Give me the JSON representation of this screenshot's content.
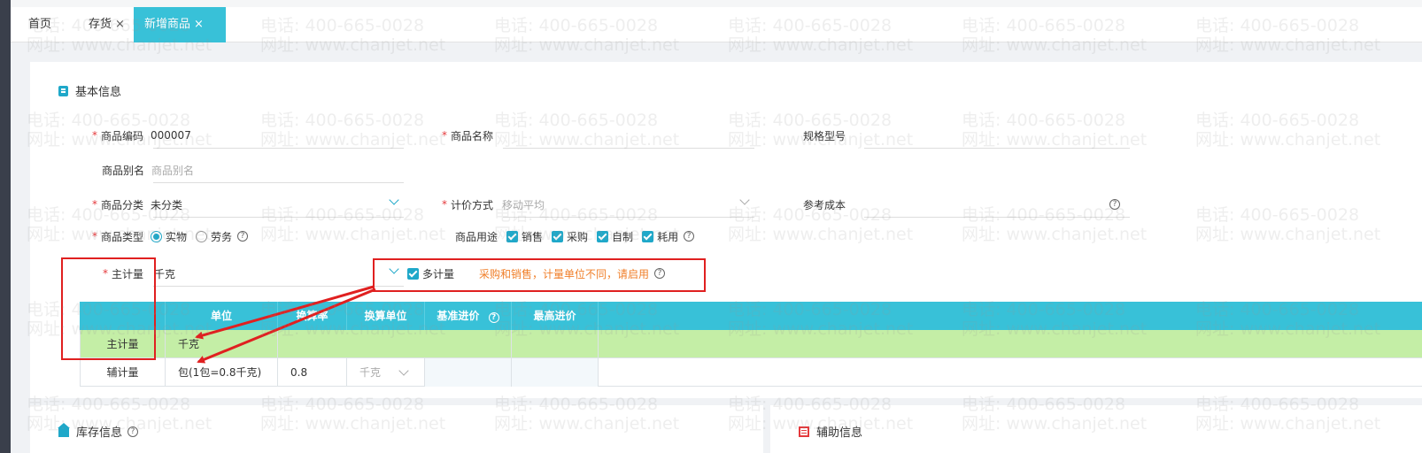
{
  "tabs": [
    {
      "label": "首页",
      "closable": false,
      "active": false
    },
    {
      "label": "存货",
      "closable": true,
      "active": false
    },
    {
      "label": "新增商品",
      "closable": true,
      "active": true
    }
  ],
  "close_glyph": "×",
  "section_basic": {
    "title": "基本信息",
    "icon": "edit-note-icon"
  },
  "form": {
    "code": {
      "label": "商品编码",
      "value": "000007",
      "required": true
    },
    "name": {
      "label": "商品名称",
      "value": "",
      "required": true
    },
    "spec": {
      "label": "规格型号",
      "value": ""
    },
    "alias": {
      "label": "商品别名",
      "placeholder": "商品别名"
    },
    "category": {
      "label": "商品分类",
      "value": "未分类",
      "required": true
    },
    "valuation": {
      "label": "计价方式",
      "value": "移动平均",
      "required": true
    },
    "ref_cost": {
      "label": "参考成本",
      "value": ""
    },
    "type": {
      "label": "商品类型",
      "options": [
        "实物",
        "劳务"
      ],
      "selected": "实物",
      "required": true
    },
    "usage": {
      "label": "商品用途",
      "options": [
        "销售",
        "采购",
        "自制",
        "耗用"
      ]
    },
    "main_unit": {
      "label": "主计量",
      "value": "千克",
      "required": true
    },
    "multi_unit": {
      "label": "多计量",
      "checked": true
    },
    "multi_unit_hint": "采购和销售，计量单位不同，请启用",
    "help_glyph": "?"
  },
  "unit_table": {
    "headers": [
      "",
      "单位",
      "换算率",
      "换算单位",
      "基准进价",
      "最高进价"
    ],
    "rows": [
      {
        "kind": "主计量",
        "unit": "千克",
        "rate": "",
        "conv_unit": "",
        "base_price": "",
        "max_price": ""
      },
      {
        "kind": "辅计量",
        "unit": "包(1包=0.8千克)",
        "rate": "0.8",
        "conv_unit": "千克",
        "base_price": "",
        "max_price": ""
      }
    ]
  },
  "bottom": {
    "stock_info": {
      "title": "库存信息",
      "icon": "home-icon"
    },
    "aux_info": {
      "title": "辅助信息",
      "icon": "list-icon"
    }
  },
  "watermark": {
    "phone": "电话: 400-665-0028",
    "site": "网址: www.chanjet.net"
  },
  "colors": {
    "accent": "#38c1d8",
    "main_row": "#c4eea6",
    "required": "#e4393c",
    "hint": "#f07f2a",
    "annotation": "#e02020"
  }
}
